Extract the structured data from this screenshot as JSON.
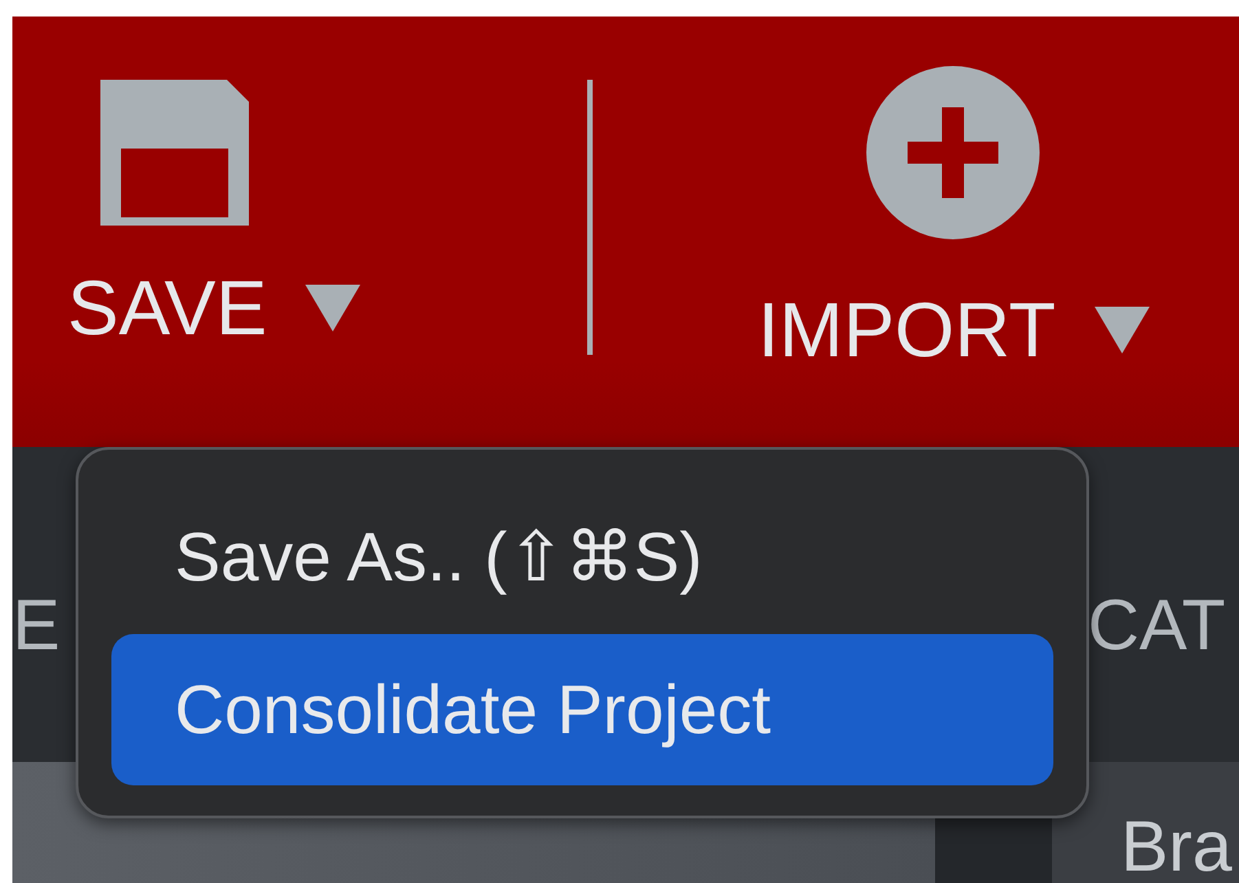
{
  "toolbar": {
    "buttons": [
      {
        "label": "SAVE",
        "kind": "save"
      },
      {
        "label": "IMPORT",
        "kind": "import"
      }
    ]
  },
  "table": {
    "column_1": "E",
    "column_2": "CAT",
    "row_text": "Bra"
  },
  "menu": {
    "items": [
      {
        "label": "Save As.. (⇧⌘S)",
        "selected": false
      },
      {
        "label": "Consolidate Project",
        "selected": true
      }
    ]
  }
}
